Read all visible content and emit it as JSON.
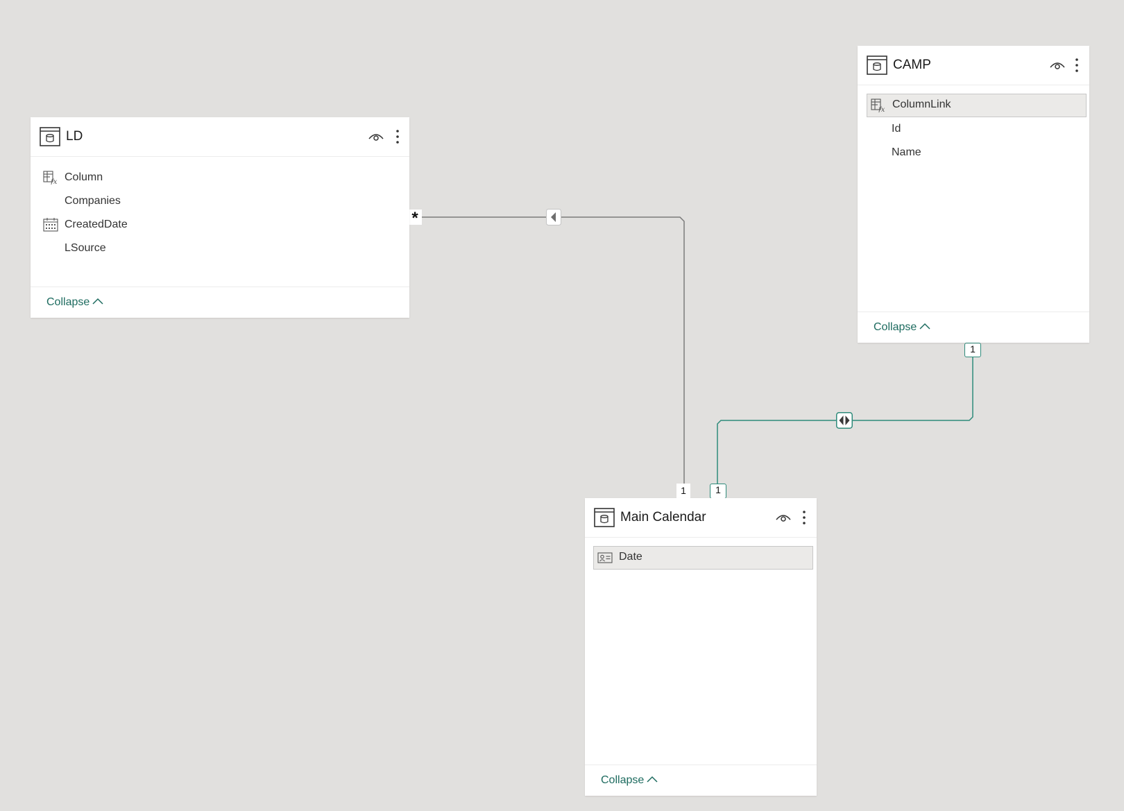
{
  "tables": {
    "ld": {
      "title": "LD",
      "fields": [
        {
          "label": "Column",
          "icon": "calculated-column-icon"
        },
        {
          "label": "Companies",
          "icon": ""
        },
        {
          "label": "CreatedDate",
          "icon": "calendar-icon"
        },
        {
          "label": "LSource",
          "icon": ""
        }
      ],
      "collapse_label": "Collapse"
    },
    "camp": {
      "title": "CAMP",
      "fields": [
        {
          "label": "ColumnLink",
          "icon": "calculated-column-icon",
          "selected": true
        },
        {
          "label": "Id",
          "icon": ""
        },
        {
          "label": "Name",
          "icon": ""
        }
      ],
      "collapse_label": "Collapse"
    },
    "main_calendar": {
      "title": "Main Calendar",
      "fields": [
        {
          "label": "Date",
          "icon": "id-card-icon",
          "selected": true
        }
      ],
      "collapse_label": "Collapse"
    }
  },
  "relationships": {
    "ld_to_calendar": {
      "from_cardinality": "*",
      "to_cardinality": "1",
      "direction_icon": "single-direction-arrow-icon"
    },
    "camp_to_calendar": {
      "from_cardinality": "1",
      "to_cardinality": "1",
      "direction_icon": "both-direction-arrow-icon"
    }
  },
  "colors": {
    "canvas": "#e1e0de",
    "accent_teal": "#1d6b5f",
    "relationship_gray": "#7a7a7a",
    "relationship_teal": "#2e8a7a"
  }
}
